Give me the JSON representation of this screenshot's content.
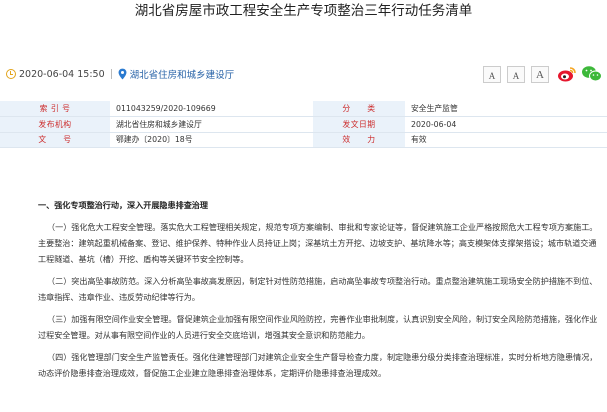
{
  "title": "湖北省房屋市政工程安全生产专项整治三年行动任务清单",
  "meta": {
    "date": "2020-06-04 15:50",
    "source": "湖北省住房和城乡建设厅"
  },
  "font_buttons": [
    "A",
    "A",
    "A"
  ],
  "info": [
    {
      "k1": "索 引 号",
      "v1": "011043259/2020-109669",
      "k2": "分　　类",
      "v2": "安全生产监管"
    },
    {
      "k1": "发布机构",
      "v1": "湖北省住房和城乡建设厅",
      "k2": "发文日期",
      "v2": "2020-06-04"
    },
    {
      "k1": "文　　号",
      "v1": "鄂建办〔2020〕18号",
      "k2": "效　　力",
      "v2": "有效"
    }
  ],
  "content": {
    "heading": "一、强化专项整治行动，深入开展隐患排查治理",
    "paragraphs": [
      "（一）强化危大工程安全管理。落实危大工程管理相关规定，规范专项方案编制、审批和专家论证等，督促建筑施工企业严格按照危大工程专项方案施工。主要整治：建筑起重机械备案、登记、维护保养、特种作业人员持证上岗；深基坑土方开挖、边坡支护、基坑降水等；高支模架体支撑架搭设；城市轨道交通工程隧道、基坑（槽）开挖、盾构等关键环节安全控制等。",
      "（二）突出高坠事故防范。深入分析高坠事故高发原因，制定针对性防范措施，启动高坠事故专项整治行动。重点整治建筑施工现场安全防护措施不到位、违章指挥、违章作业、违反劳动纪律等行为。",
      "（三）加强有限空间作业安全管理。督促建筑企业加强有限空间作业风险防控，完善作业审批制度，认真识别安全风险，制订安全风险防范措施，强化作业过程安全管理。对从事有限空间作业的人员进行安全交底培训，增强其安全意识和防范能力。",
      "（四）强化管理部门安全生产监管责任。强化住建管理部门对建筑企业安全生产督导检查力度，制定隐患分级分类排查治理标准，实时分析地方隐患情况，动态评价隐患排查治理成效，督促施工企业建立隐患排查治理体系，定期评价隐患排查治理成效。"
    ]
  }
}
